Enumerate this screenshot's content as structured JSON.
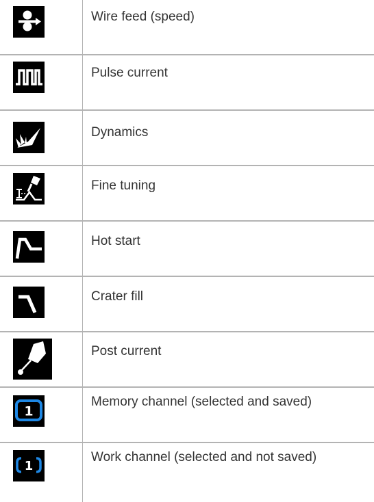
{
  "rows": [
    {
      "label": "Wire feed (speed)",
      "icon": "wire-feed-icon"
    },
    {
      "label": "Pulse current",
      "icon": "pulse-current-icon"
    },
    {
      "label": "Dynamics",
      "icon": "dynamics-icon"
    },
    {
      "label": "Fine tuning",
      "icon": "fine-tuning-icon"
    },
    {
      "label": "Hot start",
      "icon": "hot-start-icon"
    },
    {
      "label": "Crater fill",
      "icon": "crater-fill-icon"
    },
    {
      "label": "Post current",
      "icon": "post-current-icon"
    },
    {
      "label": "Memory channel (selected and saved)",
      "icon": "memory-channel-icon",
      "digit": "1"
    },
    {
      "label": "Work channel (selected and not saved)",
      "icon": "work-channel-icon",
      "digit": "1"
    }
  ],
  "colors": {
    "text": "#333333",
    "divider": "#b3b3b3",
    "icon_background": "#000000",
    "icon_foreground": "#ffffff",
    "channel_accent": "#1e88e5"
  }
}
